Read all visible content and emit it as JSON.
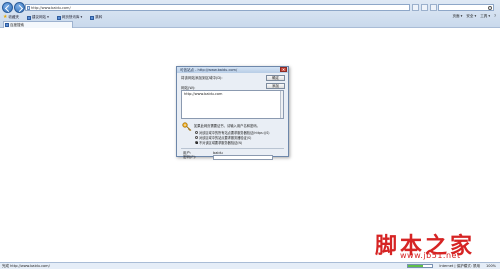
{
  "browser": {
    "url": "http://www.baidu.com/",
    "favorites_label": "收藏夹",
    "fav_items": [
      "建议网站 ▾",
      "网页快讯库 ▾",
      "跳转"
    ],
    "tab_label": "百度搜索",
    "cmd_items": [
      "页面 ▾",
      "安全 ▾",
      "工具 ▾",
      "?"
    ]
  },
  "dialog": {
    "title": "可信站点 - http://www.baidu.com/",
    "close_glyph": "✕",
    "add_zone_text": "将该网站添加到区域中(D):",
    "ok_button": "确定",
    "add_button": "添加",
    "websites_label": "网站(W):",
    "list_items": [
      "http://www.baidu.com"
    ],
    "warning_text": "如果此网页需要证书，请输入用户名和密码。",
    "radio_options": [
      "对该区域中的所有站点要求服务器验证(https:)(S)",
      "对该区域中的站点要求服务器验证(S)",
      "不对该区域要求服务器验证(N)"
    ],
    "selected_radio": 2,
    "field1_label": "用户:",
    "field1_value": "baidu",
    "field2_label": "密码(P):"
  },
  "statusbar": {
    "left_text": "完成 http://www.baidu.com/",
    "zone_text": "Internet | 保护模式: 禁用",
    "zoom_text": "100%",
    "progress_fraction": 0.6,
    "progress_color": "#5fbf4a"
  },
  "watermark": {
    "big": "脚本之家",
    "small": "www.jb51.net"
  }
}
